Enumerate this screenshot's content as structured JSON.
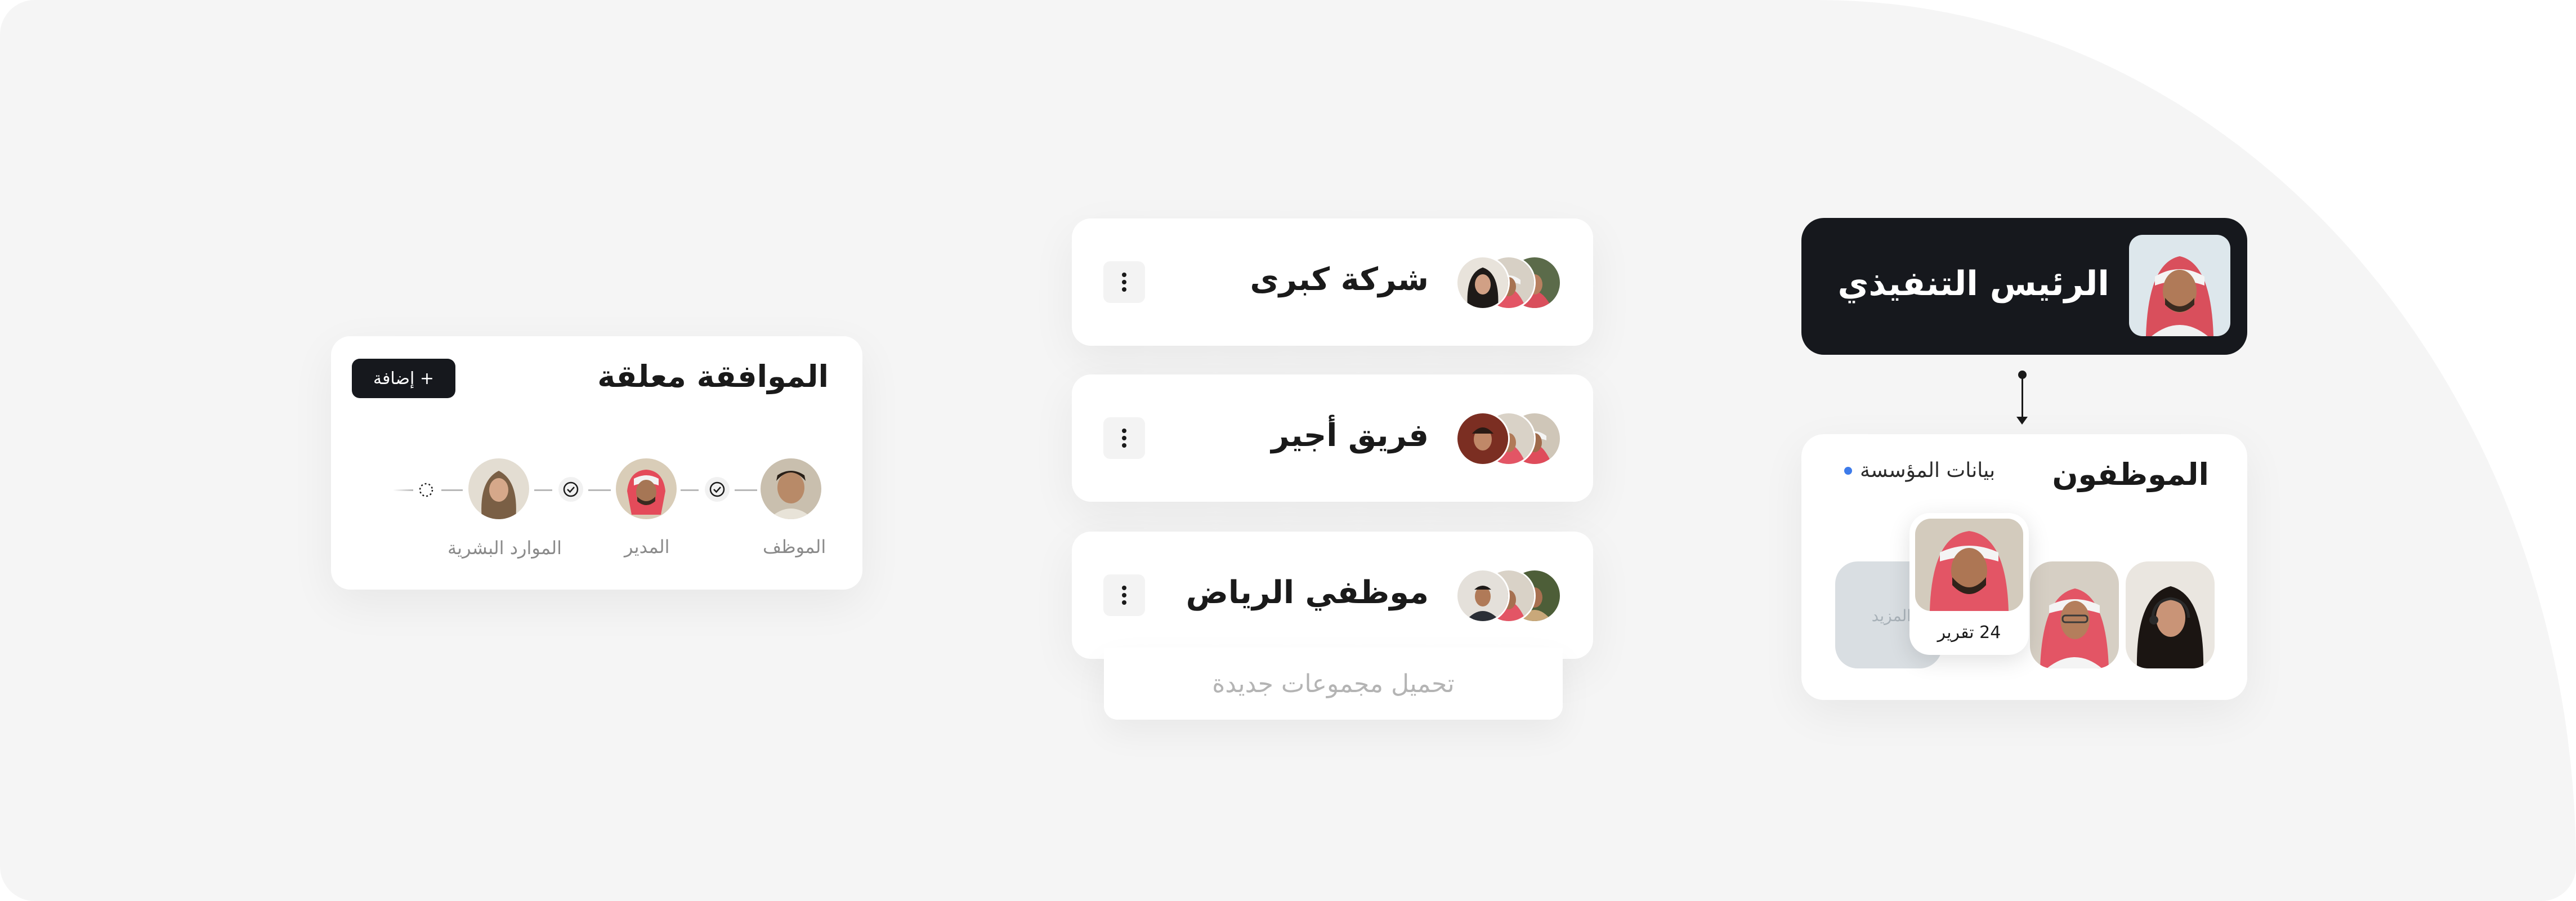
{
  "approval": {
    "title": "الموافقة معلقة",
    "add_button": "+ إضافة",
    "steps": [
      {
        "label": "الموظف"
      },
      {
        "label": "المدير"
      },
      {
        "label": "الموارد البشرية"
      }
    ]
  },
  "teams": [
    {
      "name": "شركة كبرى"
    },
    {
      "name": "فريق أجير"
    },
    {
      "name": "موظفي الرياض"
    }
  ],
  "load_more": "تحميل مجموعات جديدة",
  "ceo": {
    "title": "الرئيس التنفيذي"
  },
  "employees": {
    "title": "الموظفون",
    "org_data_label": "بيانات المؤسسة",
    "report_caption": "24 تقرير",
    "more_label": "عرض المزيد"
  },
  "colors": {
    "dark": "#16181d",
    "background": "#f5f5f5",
    "accent_blue": "#3d7bea"
  }
}
